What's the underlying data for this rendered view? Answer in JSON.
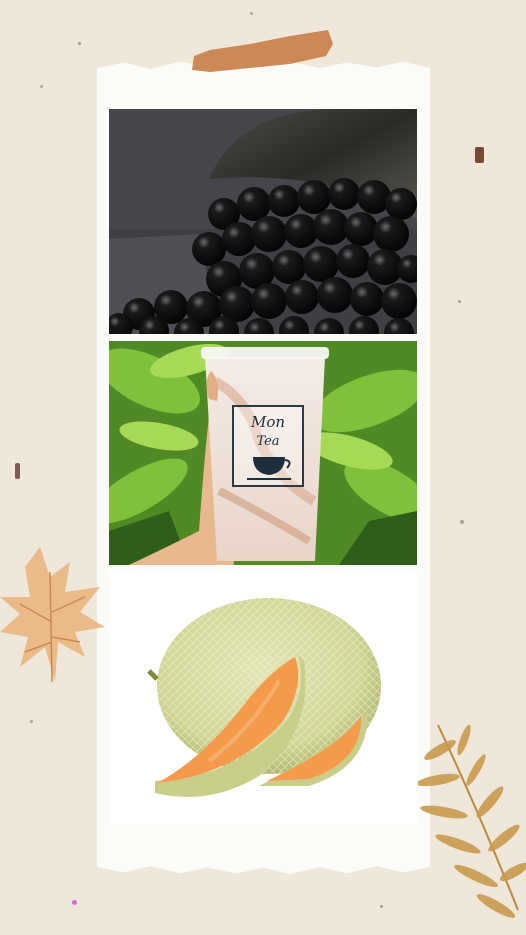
{
  "colors": {
    "background": "#efe7d9",
    "paper": "#fbfbf8",
    "tape": "#c9844f",
    "boba": "#111111",
    "leaf_green": "#5fa52a",
    "melon_flesh": "#f59a4a",
    "melon_rind": "#c9cf8a",
    "maple_leaf": "#e9b27a",
    "fern": "#c99a4e"
  },
  "photos": [
    {
      "name": "tapioca-pearls-photo"
    },
    {
      "name": "milk-tea-cup-photo"
    },
    {
      "name": "cantaloupe-melon-photo"
    }
  ],
  "cup_logo": {
    "line1": "Mon",
    "line2": "Tea"
  }
}
